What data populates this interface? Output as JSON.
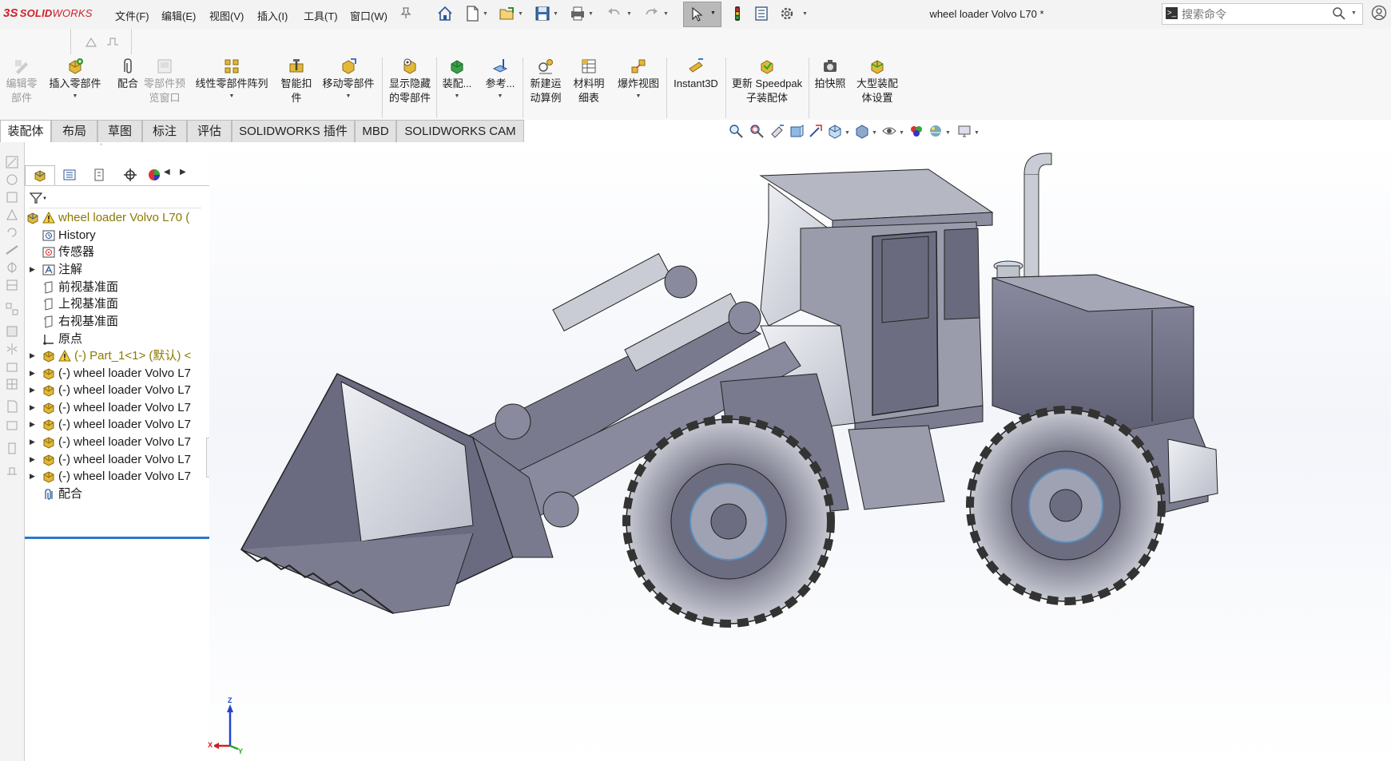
{
  "app": {
    "logo_ds": "3S",
    "logo_solid": "SOLID",
    "logo_works": "WORKS"
  },
  "menu": [
    {
      "label": "文件(F)"
    },
    {
      "label": "编辑(E)"
    },
    {
      "label": "视图(V)"
    },
    {
      "label": "插入(I)"
    },
    {
      "label": "工具(T)"
    },
    {
      "label": "窗口(W)"
    }
  ],
  "document": {
    "title": "wheel loader Volvo L70 *"
  },
  "search": {
    "placeholder": "搜索命令"
  },
  "commands": [
    {
      "label": "编辑零部件",
      "enabled": false
    },
    {
      "label": "插入零部件",
      "enabled": true
    },
    {
      "label": "配合",
      "enabled": true
    },
    {
      "label": "零部件预览窗口",
      "enabled": false
    },
    {
      "label": "线性零部件阵列",
      "enabled": true
    },
    {
      "label": "智能扣件",
      "enabled": true
    },
    {
      "label": "移动零部件",
      "enabled": true
    },
    {
      "label": "显示隐藏的零部件",
      "enabled": true
    },
    {
      "label": "装配...",
      "enabled": true
    },
    {
      "label": "参考...",
      "enabled": true
    },
    {
      "label": "新建运动算例",
      "enabled": true
    },
    {
      "label": "材料明细表",
      "enabled": true
    },
    {
      "label": "爆炸视图",
      "enabled": true
    },
    {
      "label": "Instant3D",
      "enabled": true
    },
    {
      "label": "更新 Speedpak 子装配体",
      "enabled": true
    },
    {
      "label": "拍快照",
      "enabled": true
    },
    {
      "label": "大型装配体设置",
      "enabled": true
    }
  ],
  "tabs": [
    {
      "label": "装配体",
      "active": true
    },
    {
      "label": "布局"
    },
    {
      "label": "草图"
    },
    {
      "label": "标注"
    },
    {
      "label": "评估"
    },
    {
      "label": "SOLIDWORKS 插件"
    },
    {
      "label": "MBD"
    },
    {
      "label": "SOLIDWORKS CAM"
    }
  ],
  "tree": {
    "root": "wheel loader Volvo L70 (",
    "items": [
      {
        "label": "History",
        "icon": "history-icon"
      },
      {
        "label": "传感器",
        "icon": "sensor-icon"
      },
      {
        "label": "注解",
        "icon": "annotation-icon"
      },
      {
        "label": "前视基准面",
        "icon": "plane-icon"
      },
      {
        "label": "上视基准面",
        "icon": "plane-icon"
      },
      {
        "label": "右视基准面",
        "icon": "plane-icon"
      },
      {
        "label": "原点",
        "icon": "origin-icon"
      },
      {
        "label": "(-) Part_1<1> (默认) <",
        "icon": "part-icon"
      },
      {
        "label": "(-) wheel loader Volvo L7",
        "icon": "assembly-icon"
      },
      {
        "label": "(-) wheel loader Volvo L7",
        "icon": "assembly-icon"
      },
      {
        "label": "(-) wheel loader Volvo L7",
        "icon": "assembly-icon"
      },
      {
        "label": "(-) wheel loader Volvo L7",
        "icon": "assembly-icon"
      },
      {
        "label": "(-) wheel loader Volvo L7",
        "icon": "assembly-icon"
      },
      {
        "label": "(-) wheel loader Volvo L7",
        "icon": "assembly-icon"
      },
      {
        "label": "(-) wheel loader Volvo L7",
        "icon": "assembly-icon"
      },
      {
        "label": "配合",
        "icon": "mates-icon"
      }
    ]
  },
  "triad": {
    "x": "X",
    "y": "Y",
    "z": "Z"
  }
}
